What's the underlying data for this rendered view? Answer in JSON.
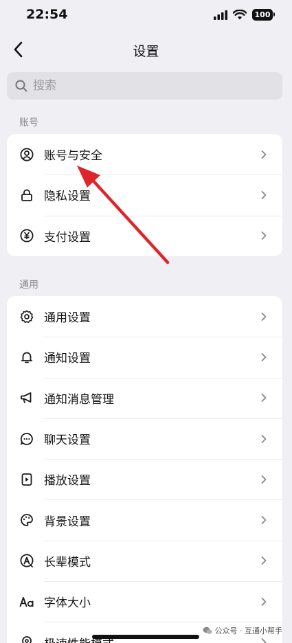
{
  "status_bar": {
    "time": "22:54",
    "battery": "100"
  },
  "nav": {
    "title": "设置",
    "back_icon": "chevron-left-icon"
  },
  "search": {
    "placeholder": "搜索"
  },
  "sections": [
    {
      "label": "账号",
      "items": [
        {
          "label": "账号与安全",
          "icon": "user-circle-icon"
        },
        {
          "label": "隐私设置",
          "icon": "lock-icon"
        },
        {
          "label": "支付设置",
          "icon": "yuan-coin-icon"
        }
      ]
    },
    {
      "label": "通用",
      "items": [
        {
          "label": "通用设置",
          "icon": "gear-icon"
        },
        {
          "label": "通知设置",
          "icon": "bell-icon"
        },
        {
          "label": "通知消息管理",
          "icon": "megaphone-icon"
        },
        {
          "label": "聊天设置",
          "icon": "chat-bubble-icon"
        },
        {
          "label": "播放设置",
          "icon": "play-file-icon"
        },
        {
          "label": "背景设置",
          "icon": "palette-icon"
        },
        {
          "label": "长辈模式",
          "icon": "elder-mode-icon"
        },
        {
          "label": "字体大小",
          "icon": "font-size-icon"
        },
        {
          "label": "极速性能模式",
          "icon": "speed-mode-icon"
        }
      ]
    }
  ],
  "annotation": {
    "color": "#e0242b"
  },
  "watermark": {
    "text": "公众号 · 互通小帮手"
  },
  "colors": {
    "background": "#efeff4",
    "card": "#ffffff",
    "search_bg": "#e2e2e6"
  }
}
